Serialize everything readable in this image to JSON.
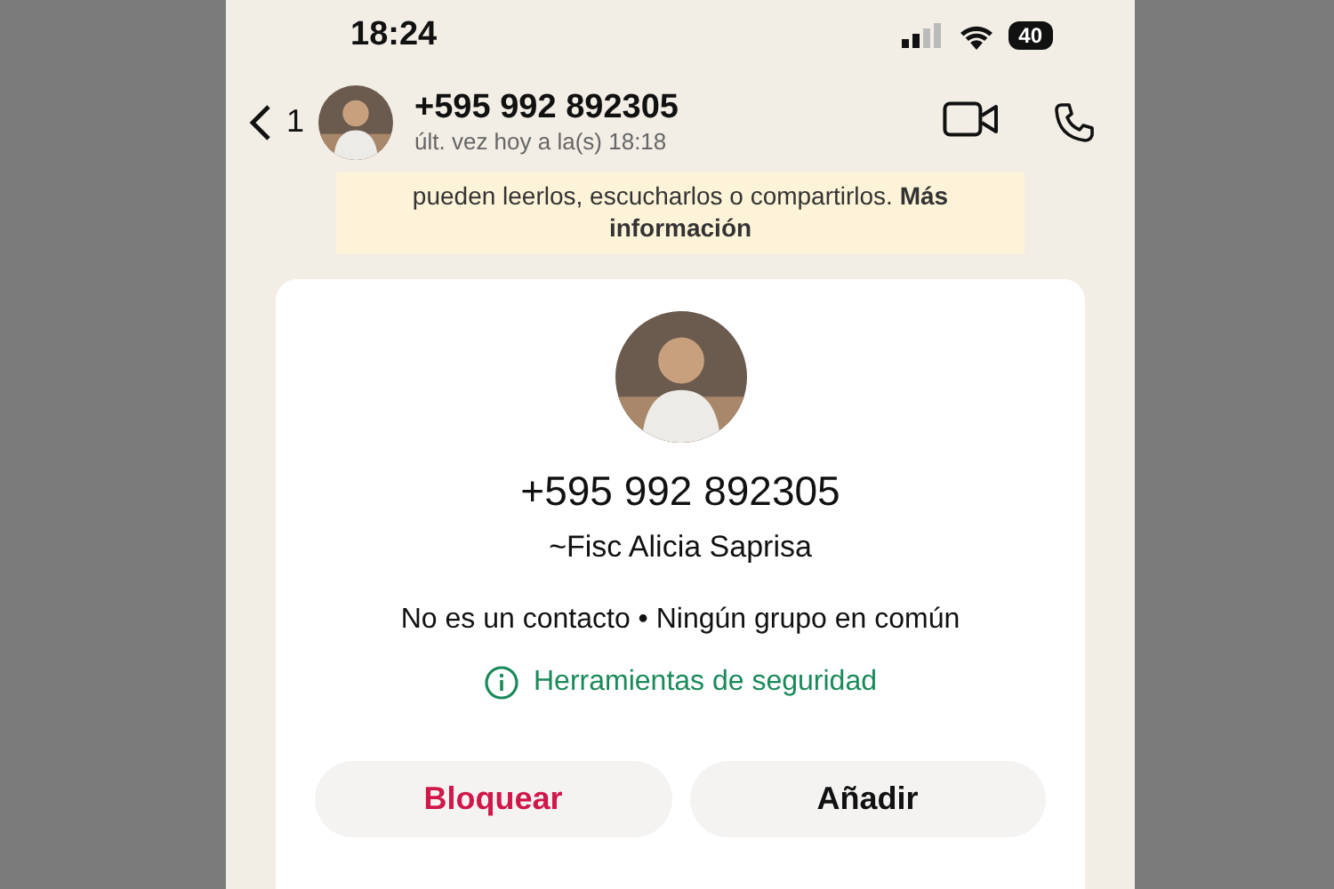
{
  "status_bar": {
    "time": "18:24",
    "battery": "40"
  },
  "header": {
    "back_count": "1",
    "title": "+595 992 892305",
    "subtitle": "últ. vez hoy a la(s) 18:18"
  },
  "banner": {
    "text": "pueden leerlos, escucharlos o compartirlos. **Más información**"
  },
  "contact_card": {
    "phone": "+595 992 892305",
    "name": "~Fisc Alicia Saprisa",
    "info": "No es un contacto • Ningún grupo en común",
    "safety_link": "Herramientas de seguridad",
    "buttons": [
      {
        "label": "Bloquear",
        "kind": "danger"
      },
      {
        "label": "Añadir",
        "kind": "default"
      }
    ]
  }
}
